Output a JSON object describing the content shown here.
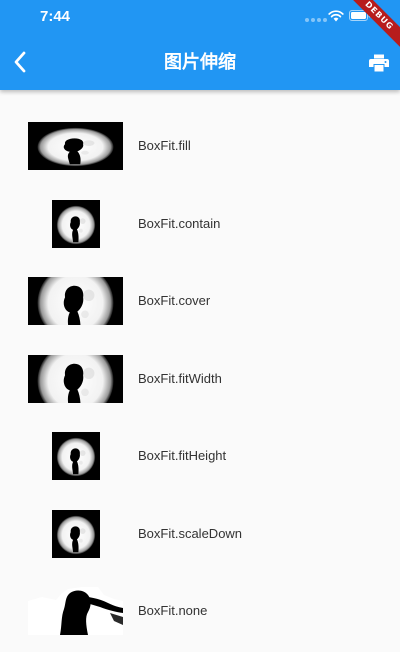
{
  "status_bar": {
    "time": "7:44",
    "wifi_icon": "wifi-icon",
    "battery_icon": "battery-icon",
    "text_color": "#ffffff"
  },
  "debug_banner": {
    "label": "DEBUG",
    "color": "#b71c1c"
  },
  "app_bar": {
    "title": "图片伸缩",
    "back_icon": "chevron-left-icon",
    "action_icon": "print-icon",
    "background_color": "#2196f3"
  },
  "fit_examples": [
    {
      "label": "BoxFit.fill",
      "mode": "fill"
    },
    {
      "label": "BoxFit.contain",
      "mode": "contain"
    },
    {
      "label": "BoxFit.cover",
      "mode": "cover"
    },
    {
      "label": "BoxFit.fitWidth",
      "mode": "fitWidth"
    },
    {
      "label": "BoxFit.fitHeight",
      "mode": "fitHeight"
    },
    {
      "label": "BoxFit.scaleDown",
      "mode": "scaleDown"
    },
    {
      "label": "BoxFit.none",
      "mode": "none"
    }
  ]
}
